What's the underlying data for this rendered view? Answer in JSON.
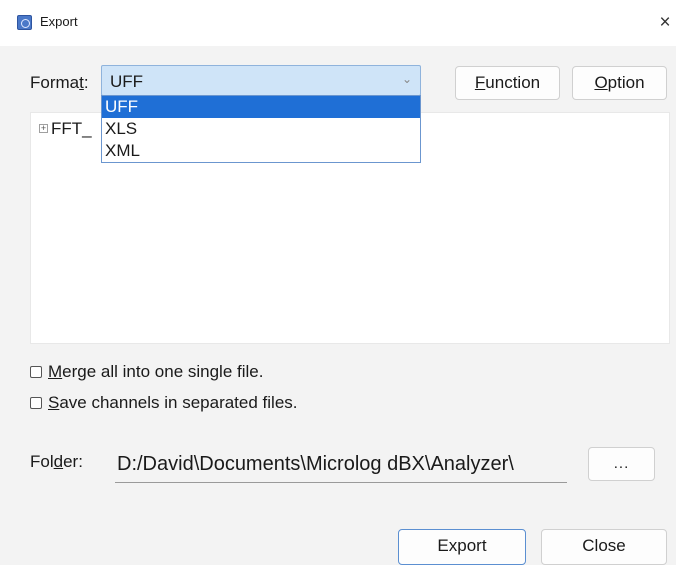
{
  "window": {
    "title": "Export",
    "close_glyph": "×",
    "app_icon": "app-icon"
  },
  "format": {
    "label_pre": "Forma",
    "label_mnemonic": "t",
    "label_post": ":",
    "selected": "UFF",
    "chevron": "⌄",
    "options": [
      "UFF",
      "XLS",
      "XML"
    ],
    "selected_index": 0
  },
  "buttons": {
    "function_mnemonic": "F",
    "function_rest": "unction",
    "option_mnemonic": "O",
    "option_rest": "ption",
    "browse": "...",
    "export": "Export",
    "close": "Close"
  },
  "tree": {
    "expander": "+",
    "item_label": "FFT_"
  },
  "options": {
    "merge_mnemonic": "M",
    "merge_rest": "erge all into one single file.",
    "merge_checked": false,
    "separate_mnemonic": "S",
    "separate_rest": "ave channels in separated files.",
    "separate_checked": false
  },
  "folder": {
    "label_pre": "Fol",
    "label_mnemonic": "d",
    "label_post": "er:",
    "path": "D:/David\\Documents\\Microlog dBX\\Analyzer\\"
  },
  "colors": {
    "selection": "#1f6fd6",
    "combo_bg": "#cfe4f8",
    "focus_border": "#5b8fd1"
  }
}
